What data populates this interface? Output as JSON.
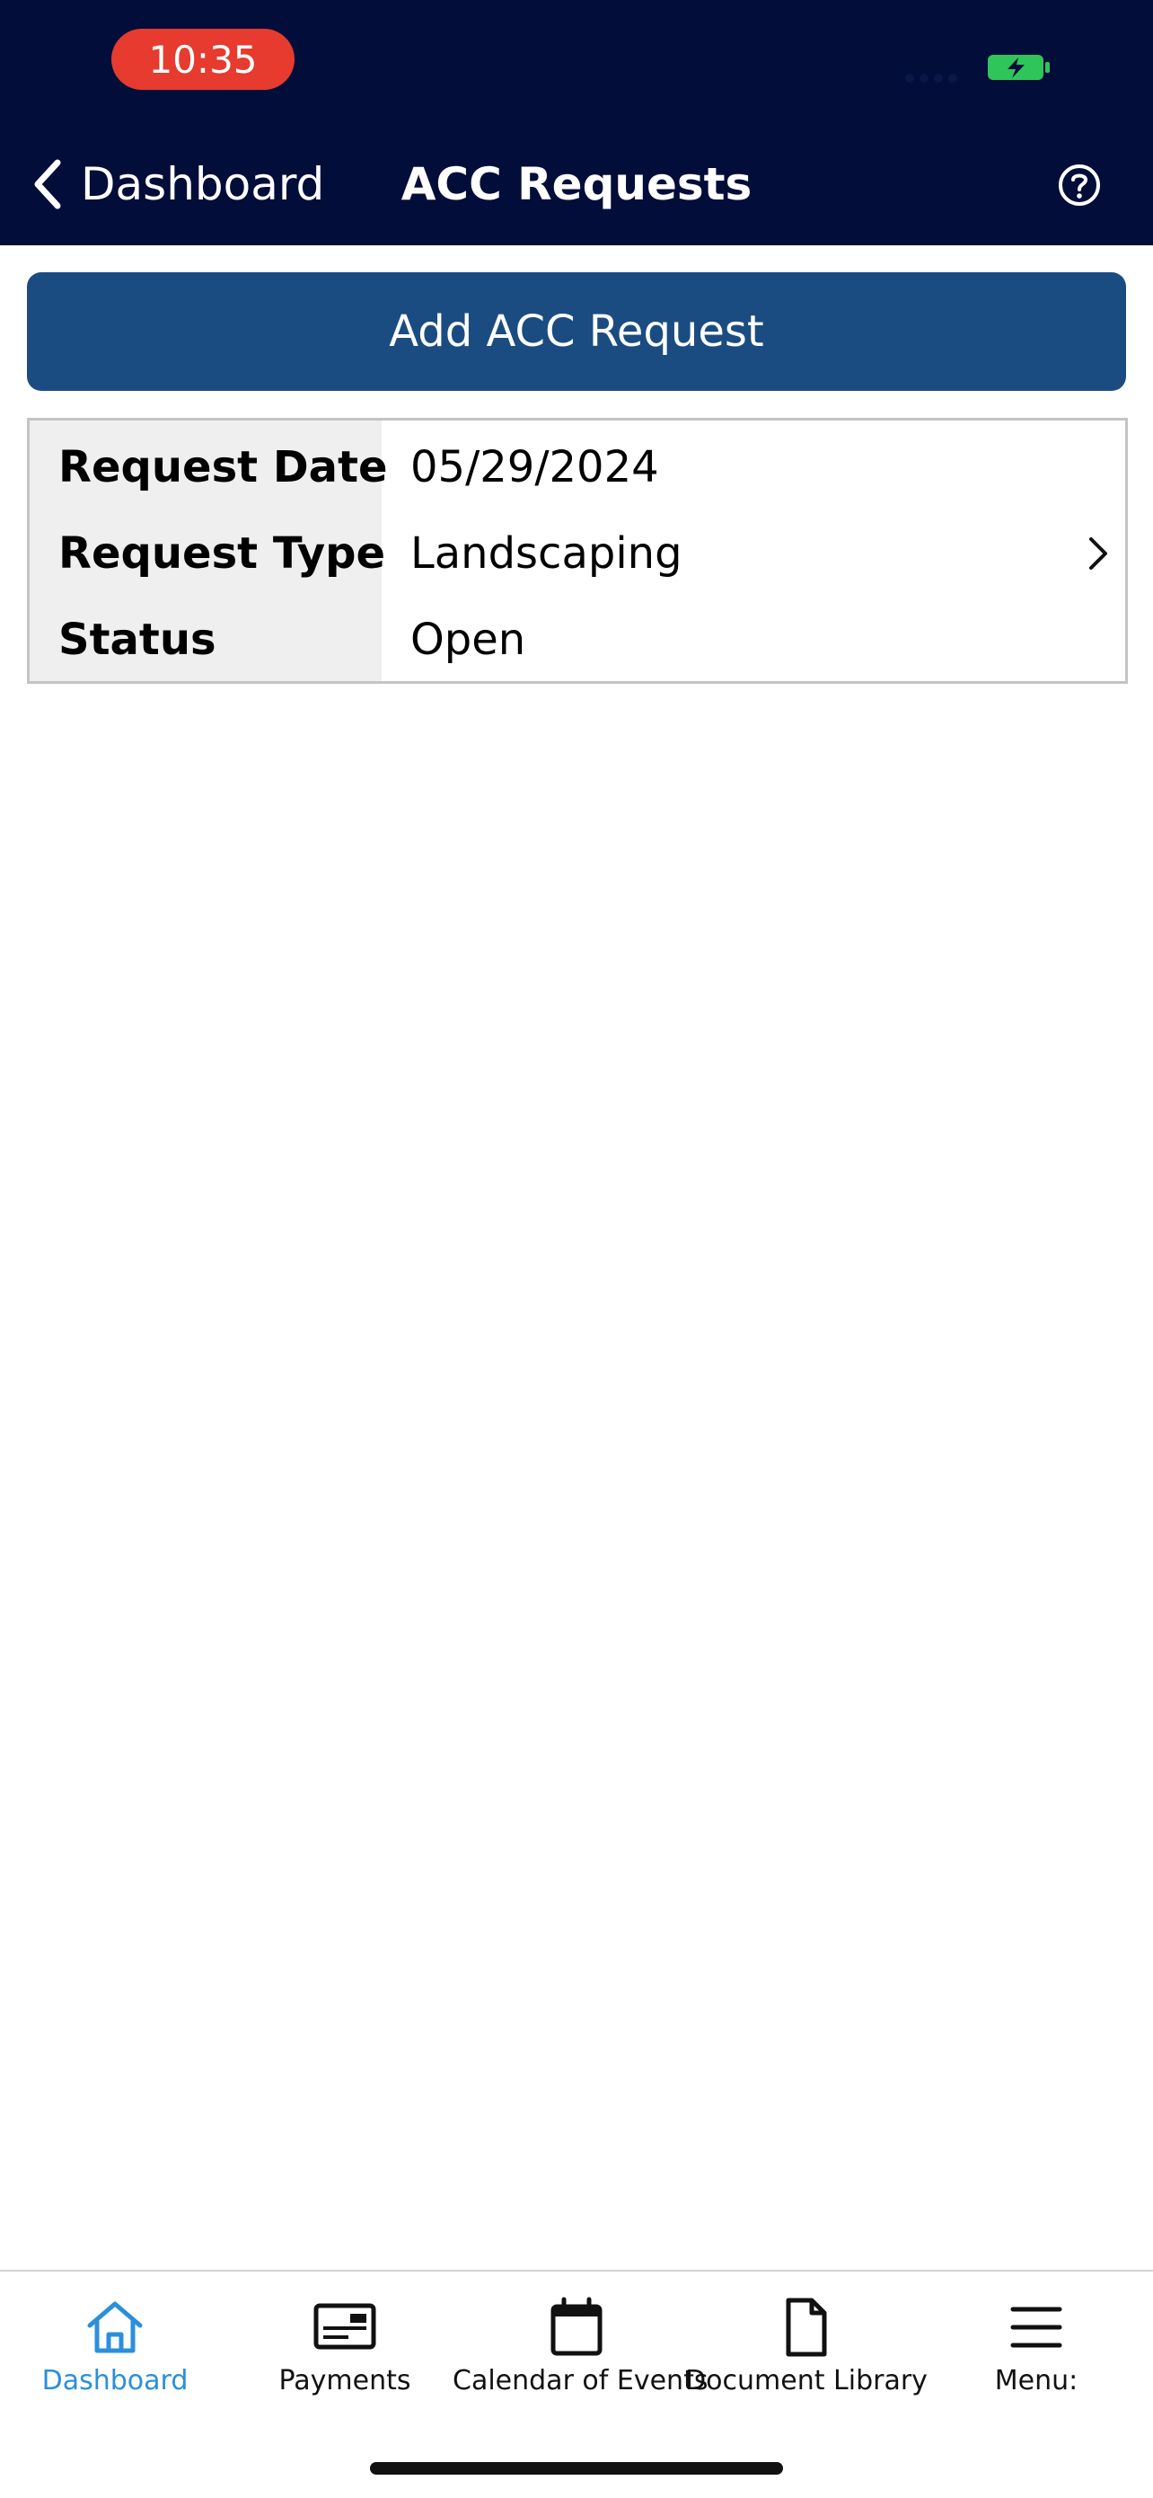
{
  "status_bar": {
    "time": "10:35"
  },
  "nav": {
    "back_label": "Dashboard",
    "title": "ACC Requests"
  },
  "actions": {
    "add_label": "Add ACC Request"
  },
  "request": {
    "date_label": "Request Date",
    "date_value": "05/29/2024",
    "type_label": "Request Type",
    "type_value": "Landscaping",
    "status_label": "Status",
    "status_value": "Open"
  },
  "tabs": [
    {
      "label": "Dashboard",
      "icon": "home-icon",
      "active": true
    },
    {
      "label": "Payments",
      "icon": "payment-card-icon",
      "active": false
    },
    {
      "label": "Calendar of Events",
      "icon": "calendar-icon",
      "active": false
    },
    {
      "label": "Document Library",
      "icon": "document-icon",
      "active": false
    },
    {
      "label": "Menu:",
      "icon": "hamburger-menu-icon",
      "active": false
    }
  ],
  "colors": {
    "header_bg": "#020d39",
    "primary_button": "#1b4c81",
    "active_tab": "#2b8fdb",
    "time_pill": "#e63b2e",
    "battery": "#2fc55a"
  }
}
